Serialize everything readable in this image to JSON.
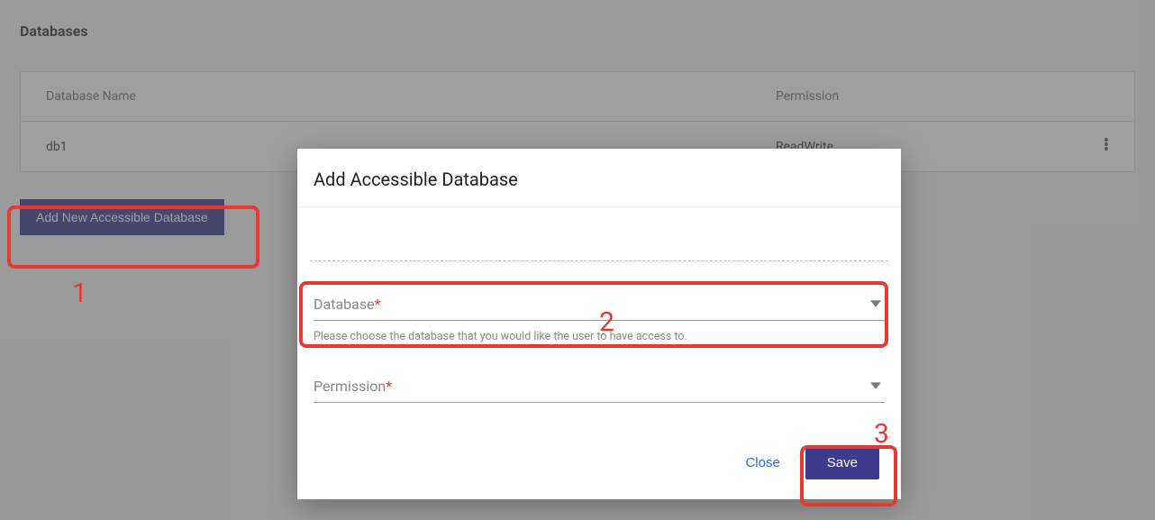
{
  "page": {
    "title": "Databases"
  },
  "table": {
    "headers": {
      "name": "Database Name",
      "permission": "Permission"
    },
    "rows": [
      {
        "name": "db1",
        "permission": "ReadWrite"
      }
    ]
  },
  "buttons": {
    "add_new": "Add New Accessible Database"
  },
  "dialog": {
    "title": "Add Accessible Database",
    "database_label": "Database",
    "database_helper": "Please choose the database that you would like the user to have access to.",
    "permission_label": "Permission",
    "required_mark": "*",
    "close": "Close",
    "save": "Save"
  },
  "annotations": {
    "n1": "1",
    "n2": "2",
    "n3": "3"
  }
}
